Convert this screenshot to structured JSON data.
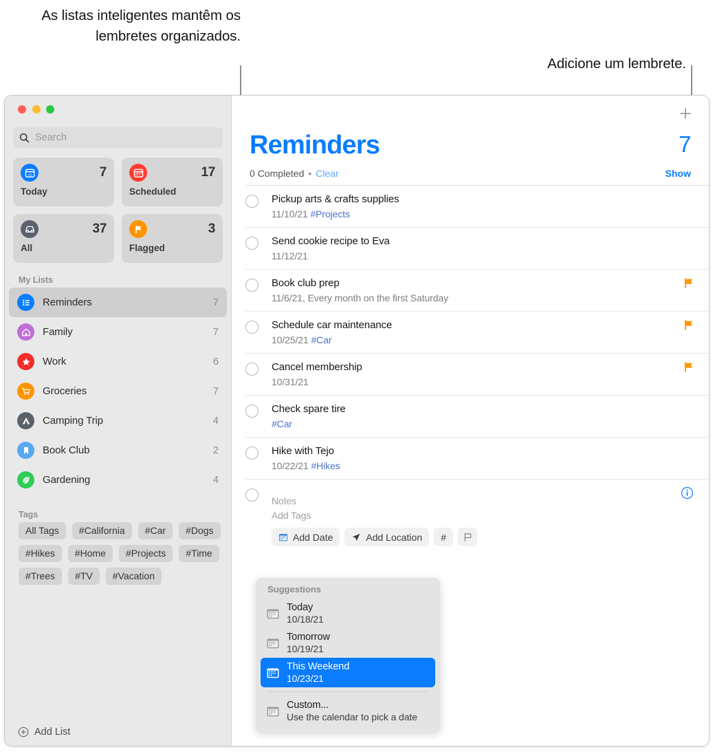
{
  "callouts": {
    "left": "As listas inteligentes mantêm os lembretes organizados.",
    "right": "Adicione um lembrete."
  },
  "sidebar": {
    "search": {
      "placeholder": "Search"
    },
    "smart_lists": [
      {
        "label": "Today",
        "count": "7",
        "icon": "calendar-day-icon",
        "color": "#0a7cff"
      },
      {
        "label": "Scheduled",
        "count": "17",
        "icon": "calendar-icon",
        "color": "#ff3b30"
      },
      {
        "label": "All",
        "count": "37",
        "icon": "tray-icon",
        "color": "#5b616b"
      },
      {
        "label": "Flagged",
        "count": "3",
        "icon": "flag-icon",
        "color": "#ff9500"
      }
    ],
    "my_lists_title": "My Lists",
    "lists": [
      {
        "name": "Reminders",
        "count": "7",
        "icon": "list-bullet-icon",
        "color": "#0a7cff",
        "selected": true
      },
      {
        "name": "Family",
        "count": "7",
        "icon": "house-icon",
        "color": "#bf6ed4",
        "selected": false
      },
      {
        "name": "Work",
        "count": "6",
        "icon": "star-icon",
        "color": "#f42b2b",
        "selected": false
      },
      {
        "name": "Groceries",
        "count": "7",
        "icon": "cart-icon",
        "color": "#ff9500",
        "selected": false
      },
      {
        "name": "Camping Trip",
        "count": "4",
        "icon": "tent-icon",
        "color": "#5b616b",
        "selected": false
      },
      {
        "name": "Book Club",
        "count": "2",
        "icon": "bookmark-icon",
        "color": "#56a9ee",
        "selected": false
      },
      {
        "name": "Gardening",
        "count": "4",
        "icon": "leaf-icon",
        "color": "#2ecc56",
        "selected": false
      }
    ],
    "tags_title": "Tags",
    "tags": [
      "All Tags",
      "#California",
      "#Car",
      "#Dogs",
      "#Hikes",
      "#Home",
      "#Projects",
      "#Time",
      "#Trees",
      "#TV",
      "#Vacation"
    ],
    "add_list_label": "Add List"
  },
  "main": {
    "title": "Reminders",
    "count": "7",
    "completed_text": "0 Completed",
    "separator": "•",
    "clear_label": "Clear",
    "show_label": "Show",
    "reminders": [
      {
        "title": "Pickup arts & crafts supplies",
        "date": "11/10/21",
        "tag": "#Projects",
        "recurrence": "",
        "flagged": false
      },
      {
        "title": "Send cookie recipe to Eva",
        "date": "11/12/21",
        "tag": "",
        "recurrence": "",
        "flagged": false
      },
      {
        "title": "Book club prep",
        "date": "11/6/21,",
        "tag": "",
        "recurrence": "Every month on the first Saturday",
        "flagged": true
      },
      {
        "title": "Schedule car maintenance",
        "date": "10/25/21",
        "tag": "#Car",
        "recurrence": "",
        "flagged": true
      },
      {
        "title": "Cancel membership",
        "date": "10/31/21",
        "tag": "",
        "recurrence": "",
        "flagged": true
      },
      {
        "title": "Check spare tire",
        "date": "",
        "tag": "#Car",
        "recurrence": "",
        "flagged": false
      },
      {
        "title": "Hike with Tejo",
        "date": "10/22/21",
        "tag": "#Hikes",
        "recurrence": "",
        "flagged": false
      }
    ],
    "editor": {
      "notes_placeholder": "Notes",
      "add_tags_placeholder": "Add Tags",
      "add_date_label": "Add Date",
      "add_location_label": "Add Location",
      "tag_button_label": "#"
    },
    "suggestions": {
      "title": "Suggestions",
      "items": [
        {
          "name": "Today",
          "sub": "10/18/21",
          "selected": false
        },
        {
          "name": "Tomorrow",
          "sub": "10/19/21",
          "selected": false
        },
        {
          "name": "This Weekend",
          "sub": "10/23/21",
          "selected": true
        }
      ],
      "custom": {
        "name": "Custom...",
        "sub": "Use the calendar to pick a date"
      }
    }
  },
  "colors": {
    "accent": "#0a7cff",
    "flag": "#ff9500",
    "tag_text": "#4a74c9"
  }
}
